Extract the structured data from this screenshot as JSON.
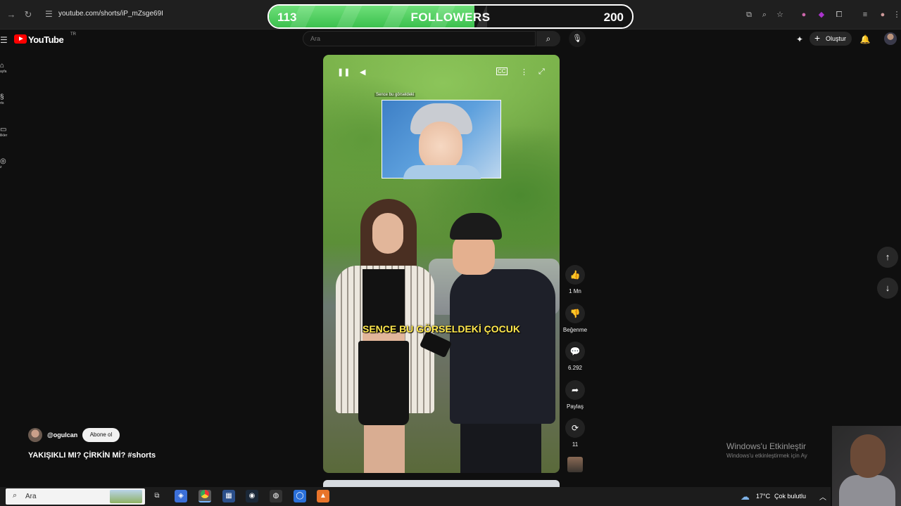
{
  "browser": {
    "url": "youtube.com/shorts/iP_mZsge69I"
  },
  "followers_widget": {
    "current": "113",
    "label": "FOLLOWERS",
    "goal": "200",
    "progress_fraction": 0.565,
    "fill_color": "#4cc95c"
  },
  "header": {
    "logo_text": "YouTube",
    "country_code": "TR",
    "search_placeholder": "Ara",
    "create_label": "Oluştur"
  },
  "guide": {
    "items": [
      {
        "label": "ayfa",
        "icon": "home-icon"
      },
      {
        "label": "rts",
        "icon": "shorts-icon"
      },
      {
        "label": "likler",
        "icon": "subscriptions-icon"
      },
      {
        "label": "z",
        "icon": "you-icon"
      }
    ]
  },
  "video": {
    "inset_label": "Sence bu görseldeki",
    "caption": "SENCE BU GÖRSELDEKİ ÇOCUK"
  },
  "actions": {
    "like_count": "1 Mn",
    "dislike_label": "Beğenme",
    "comment_count": "6.292",
    "share_label": "Paylaş",
    "remix_count": "11"
  },
  "info": {
    "handle": "@ogulcan",
    "subscribe_label": "Abone ol",
    "title": "YAKIŞIKLI MI? ÇİRKİN Mİ? #shorts"
  },
  "windows_activation": {
    "title": "Windows'u Etkinleştir",
    "subtitle": "Windows'u etkinleştirmek için Ay"
  },
  "taskbar": {
    "search_placeholder": "Ara",
    "temperature": "17°C",
    "weather": "Çok bulutlu"
  }
}
